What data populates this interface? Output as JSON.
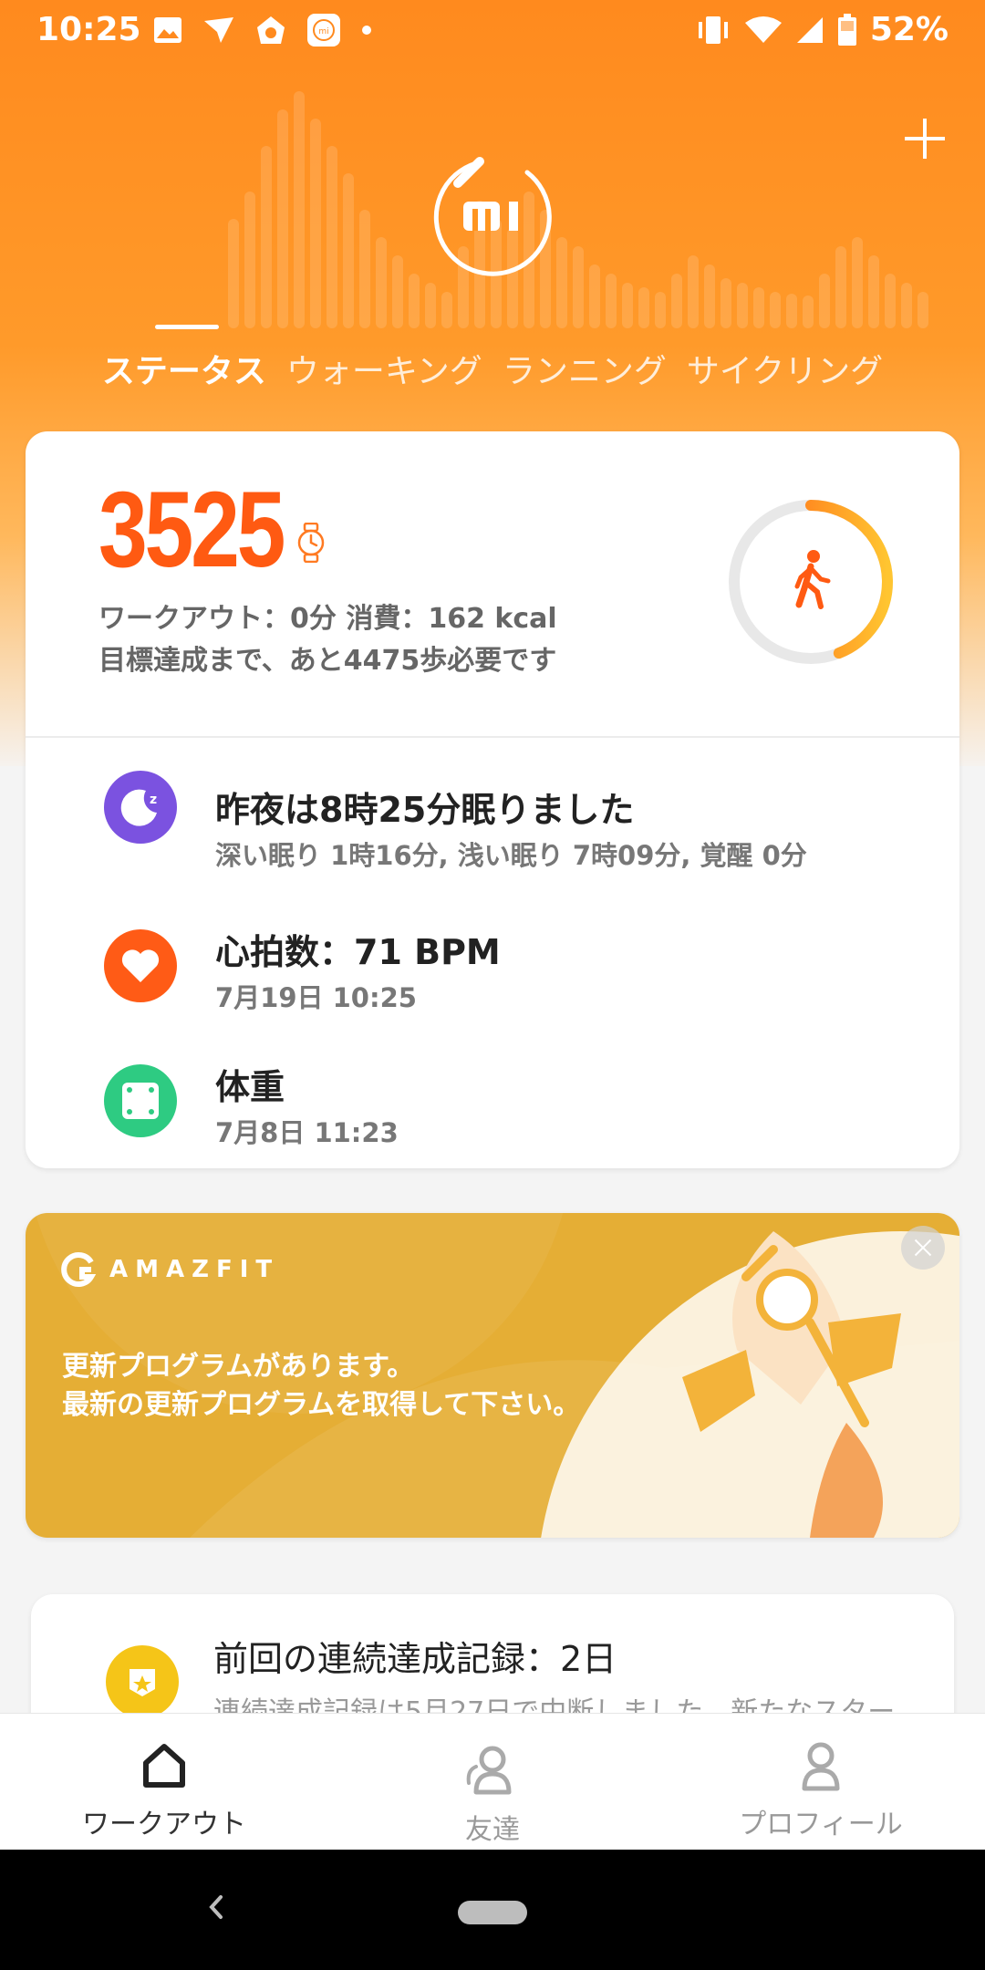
{
  "status_bar": {
    "time": "10:25",
    "battery": "52%",
    "left_icons": [
      "image-icon",
      "swift-icon",
      "soccer-icon",
      "mi-fit-icon",
      "dot-icon"
    ],
    "right_icons": [
      "vibrate-icon",
      "wifi-icon",
      "signal-icon",
      "battery-icon"
    ]
  },
  "header": {
    "logo_text": "MI",
    "add_icon": "plus-icon",
    "tabs": [
      {
        "label": "ステータス",
        "active": true
      },
      {
        "label": "ウォーキング",
        "active": false
      },
      {
        "label": "ランニング",
        "active": false
      },
      {
        "label": "サイクリング",
        "active": false
      }
    ]
  },
  "summary": {
    "steps": "3525",
    "workout_line": "ワークアウト：0分 消費：162 kcal",
    "goal_line": "目標達成まで、あと4475歩必要です",
    "goal_progress": 0.44,
    "ring_icon": "walking-icon",
    "device_icon": "watch-icon"
  },
  "rows": [
    {
      "title": "昨夜は8時25分眠りました",
      "sub": "深い眠り 1時16分, 浅い眠り 7時09分, 覚醒 0分",
      "icon": "moon-icon",
      "color": "#7b52e0"
    },
    {
      "title": "心拍数：71 BPM",
      "sub": "7月19日 10:25",
      "icon": "heart-icon",
      "color": "#ff5b16"
    },
    {
      "title": "体重",
      "sub": "7月8日 11:23",
      "icon": "scale-icon",
      "color": "#2ecb82"
    }
  ],
  "promo": {
    "brand": "AMAZFIT",
    "line1": "更新プログラムがあります。",
    "line2": "最新の更新プログラムを取得して下さい。"
  },
  "streak": {
    "title": "前回の連続達成記録：2日",
    "sub": "連続達成記録は5月27日で中断しました。新たなスター"
  },
  "bottom_nav": [
    {
      "label": "ワークアウト",
      "icon": "home-icon",
      "active": true
    },
    {
      "label": "友達",
      "icon": "friends-icon",
      "active": false
    },
    {
      "label": "プロフィール",
      "icon": "profile-icon",
      "active": false
    }
  ],
  "colors": {
    "accent": "#ff5a12",
    "header_orange": "#ff8a1e",
    "promo_gold": "#e5ae35"
  }
}
